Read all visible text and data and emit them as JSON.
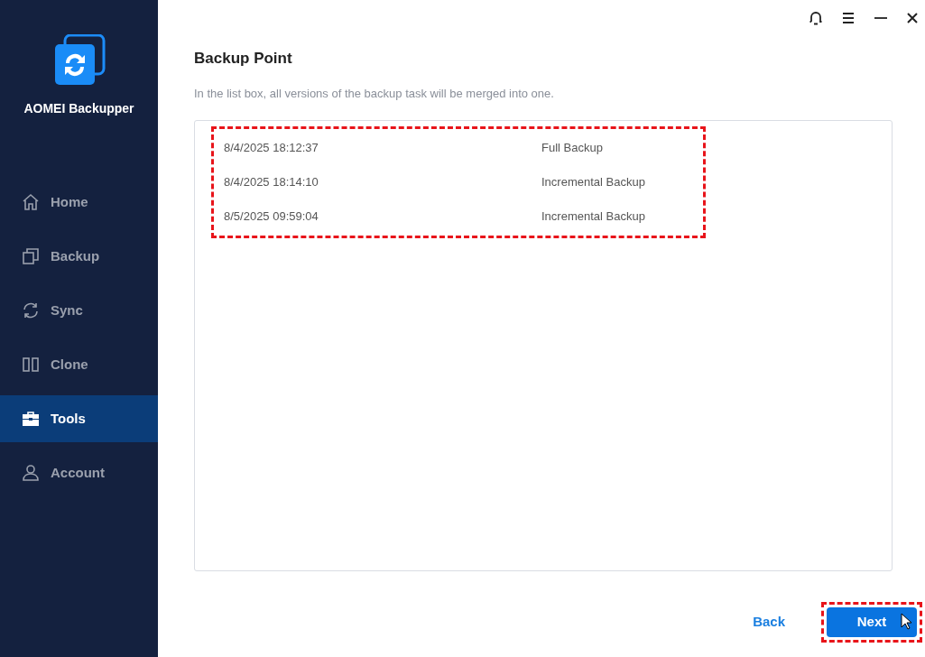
{
  "app": {
    "name": "AOMEI Backupper"
  },
  "sidebar": {
    "items": [
      {
        "label": "Home",
        "selected": false
      },
      {
        "label": "Backup",
        "selected": false
      },
      {
        "label": "Sync",
        "selected": false
      },
      {
        "label": "Clone",
        "selected": false
      },
      {
        "label": "Tools",
        "selected": true
      },
      {
        "label": "Account",
        "selected": false
      }
    ]
  },
  "page": {
    "title": "Backup Point",
    "subtitle": "In the list box, all versions of the backup task will be merged into one."
  },
  "backup_points": {
    "highlighted": true,
    "rows": [
      {
        "time": "8/4/2025 18:12:37",
        "type": "Full Backup"
      },
      {
        "time": "8/4/2025 18:14:10",
        "type": "Incremental Backup"
      },
      {
        "time": "8/5/2025 09:59:04",
        "type": "Incremental Backup"
      }
    ]
  },
  "buttons": {
    "back": "Back",
    "next": "Next",
    "next_highlighted": true
  }
}
